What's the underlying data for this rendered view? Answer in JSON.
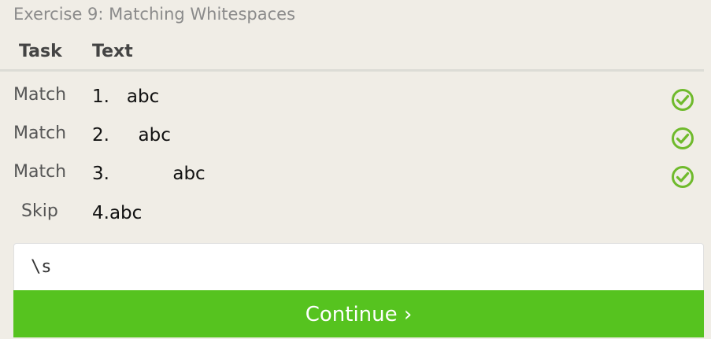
{
  "exercise": {
    "title": "Exercise 9: Matching Whitespaces"
  },
  "table": {
    "headers": {
      "task": "Task",
      "text": "Text"
    },
    "rows": [
      {
        "task": "Match",
        "text": "1.   abc",
        "status_icon": "check-circle-icon"
      },
      {
        "task": "Match",
        "text": "2.     abc",
        "status_icon": "check-circle-icon"
      },
      {
        "task": "Match",
        "text": "3.           abc",
        "status_icon": "check-circle-icon"
      },
      {
        "task": "Skip",
        "text": "4.abc",
        "status_icon": ""
      }
    ]
  },
  "input": {
    "value": "\\s",
    "placeholder": ""
  },
  "continue_button": {
    "label": "Continue ›"
  },
  "colors": {
    "background": "#f0ede6",
    "accent_green": "#56c31f",
    "check_green": "#6fba2c"
  }
}
